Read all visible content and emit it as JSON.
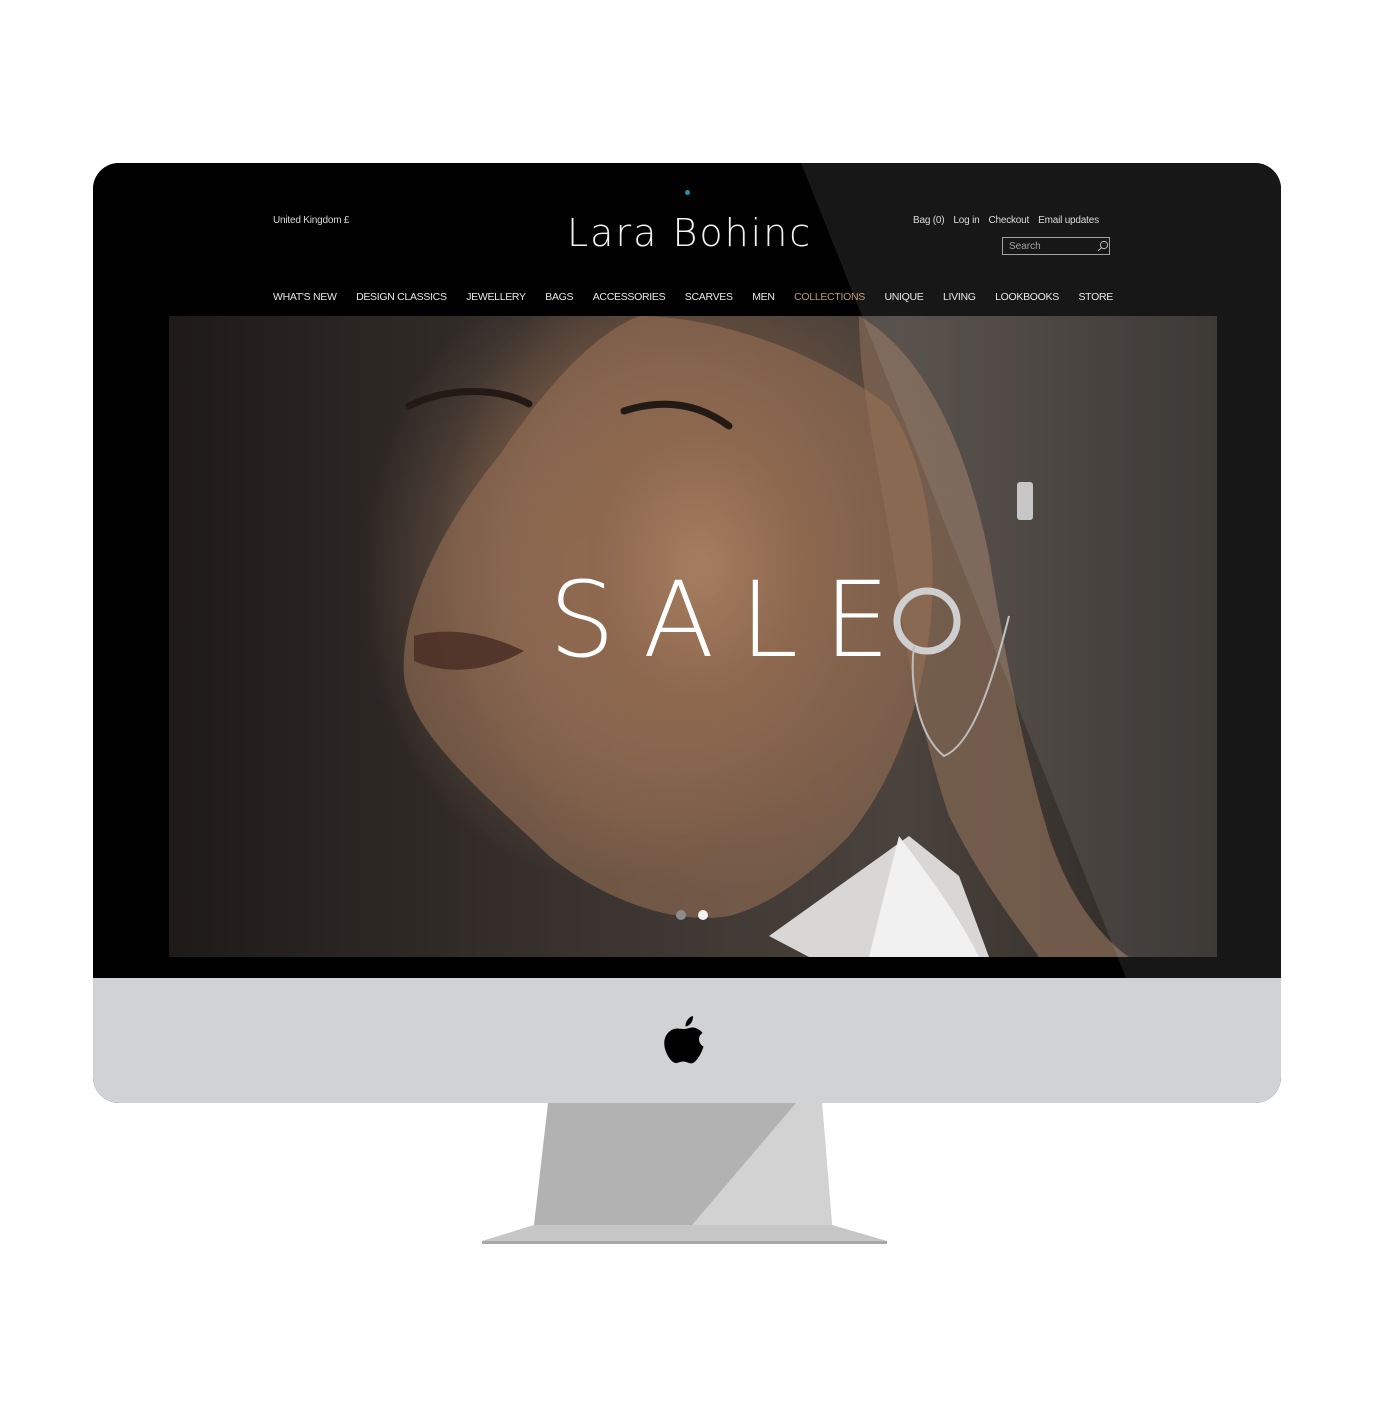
{
  "header": {
    "country": "United Kingdom  £",
    "logo": "Lara Bohinc",
    "util_links": {
      "bag": "Bag (0)",
      "login": "Log in",
      "checkout": "Checkout",
      "email": "Email updates"
    },
    "search": {
      "placeholder": "Search"
    }
  },
  "nav": {
    "items": [
      "WHAT'S NEW",
      "DESIGN CLASSICS",
      "JEWELLERY",
      "BAGS",
      "ACCESSORIES",
      "SCARVES",
      "MEN",
      "COLLECTIONS",
      "UNIQUE",
      "LIVING",
      "LOOKBOOKS",
      "STORE"
    ],
    "active": "COLLECTIONS"
  },
  "hero": {
    "headline": "SALE",
    "slides_total": 2,
    "active_slide": 2
  },
  "colors": {
    "nav_active": "#b99a6a",
    "bezel": "#000000",
    "chin": "#d1d2d4",
    "stand": "#c4c4c4"
  }
}
